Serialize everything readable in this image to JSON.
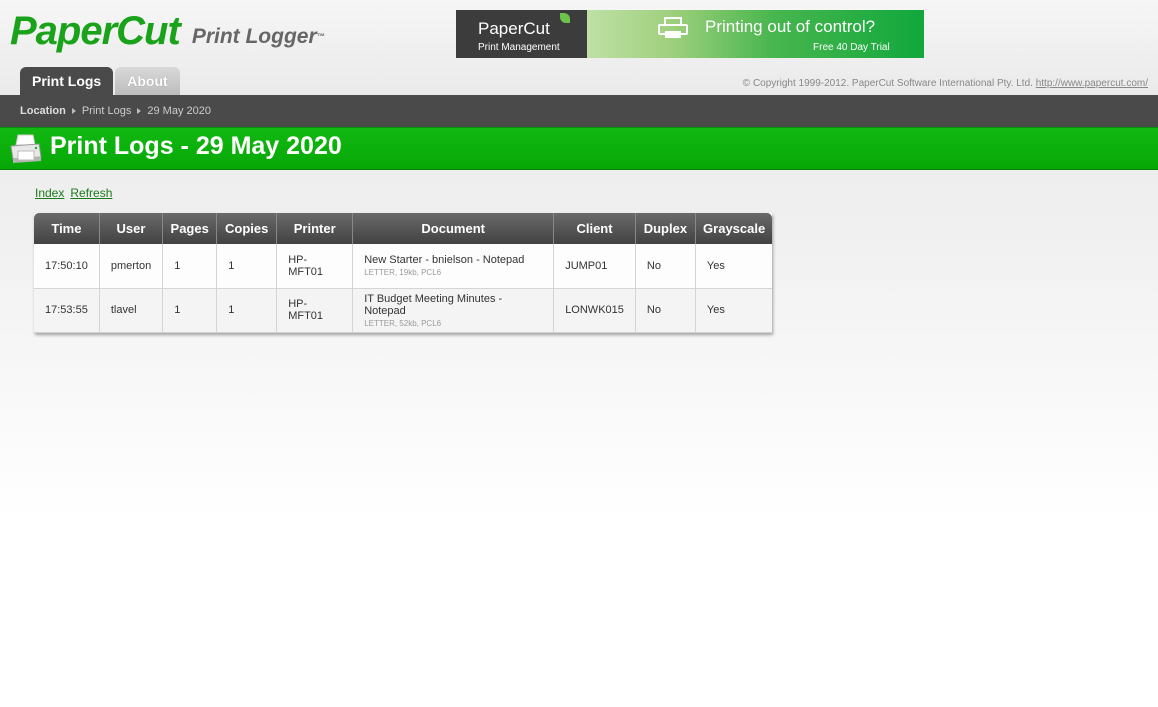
{
  "logo": {
    "main": "PaperCut",
    "sub": "Print Logger",
    "tm": "™"
  },
  "banner": {
    "brand": "PaperCut",
    "brand_sub": "Print Management",
    "headline": "Printing out of control?",
    "cta": "Free 40 Day Trial"
  },
  "tabs": [
    {
      "label": "Print Logs",
      "active": true
    },
    {
      "label": "About",
      "active": false
    }
  ],
  "copyright": {
    "text": "© Copyright 1999-2012. PaperCut Software International Pty. Ltd.",
    "link": "http://www.papercut.com/"
  },
  "breadcrumb": {
    "location": "Location",
    "items": [
      "Print Logs",
      "29 May 2020"
    ]
  },
  "page_title": "Print Logs - 29 May 2020",
  "actions": {
    "index": "Index",
    "refresh": "Refresh"
  },
  "table": {
    "headers": [
      "Time",
      "User",
      "Pages",
      "Copies",
      "Printer",
      "Document",
      "Client",
      "Duplex",
      "Grayscale"
    ],
    "rows": [
      {
        "time": "17:50:10",
        "user": "pmerton",
        "pages": "1",
        "copies": "1",
        "printer": "HP-MFT01",
        "document": "New Starter - bnielson - Notepad",
        "document_meta": "LETTER, 19kb, PCL6",
        "client": "JUMP01",
        "duplex": "No",
        "grayscale": "Yes"
      },
      {
        "time": "17:53:55",
        "user": "tlavel",
        "pages": "1",
        "copies": "1",
        "printer": "HP-MFT01",
        "document": "IT Budget Meeting Minutes - Notepad",
        "document_meta": "LETTER, 52kb, PCL6",
        "client": "LONWK015",
        "duplex": "No",
        "grayscale": "Yes"
      }
    ]
  },
  "colors": {
    "brand_green": "#1aa31a",
    "title_bar": "#08aa08",
    "dark_bar": "#4a4a4a"
  },
  "icons": {
    "title": "printer-icon",
    "banner": "printer-icon",
    "leaf": "leaf-icon"
  }
}
